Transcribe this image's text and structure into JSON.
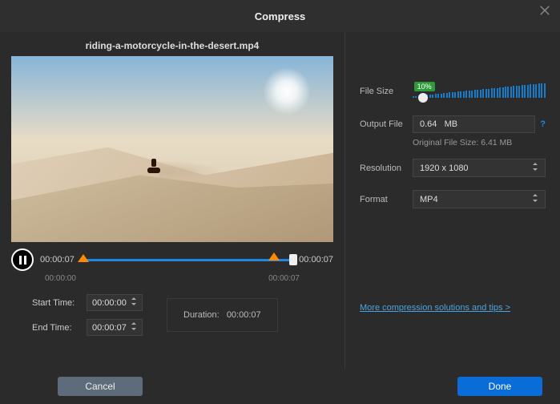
{
  "header": {
    "title": "Compress"
  },
  "file": {
    "name": "riding-a-motorcycle-in-the-desert.mp4"
  },
  "playback": {
    "current_time": "00:00:07",
    "total_time": "00:00:07",
    "scale_start": "00:00:00",
    "scale_end": "00:00:07"
  },
  "trim": {
    "start_label": "Start Time:",
    "start_value": "00:00:00",
    "end_label": "End Time:",
    "end_value": "00:00:07",
    "duration_label": "Duration:",
    "duration_value": "00:00:07"
  },
  "settings": {
    "filesize_label": "File Size",
    "filesize_percent": "10%",
    "output_label": "Output File",
    "output_value": "0.64   MB",
    "original_hint": "Original File Size: 6.41 MB",
    "resolution_label": "Resolution",
    "resolution_value": "1920 x 1080",
    "format_label": "Format",
    "format_value": "MP4"
  },
  "link": {
    "text": "More compression solutions and tips >"
  },
  "buttons": {
    "cancel": "Cancel",
    "done": "Done"
  }
}
